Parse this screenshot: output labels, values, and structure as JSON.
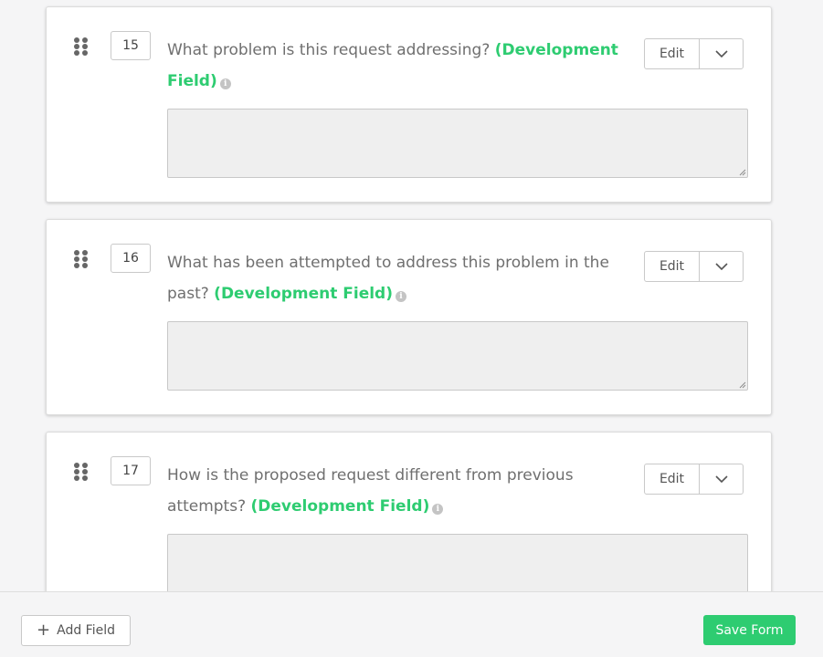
{
  "fields": [
    {
      "number": "15",
      "question": "What problem is this request addressing?",
      "tag": "(Development Field)",
      "info_icon": "info-icon",
      "edit_label": "Edit",
      "caret_icon": "chevron-down-icon"
    },
    {
      "number": "16",
      "question": "What has been attempted to address this problem in the past?",
      "tag": "(Development Field)",
      "info_icon": "info-icon",
      "edit_label": "Edit",
      "caret_icon": "chevron-down-icon"
    },
    {
      "number": "17",
      "question": "How is the proposed request different from previous attempts?",
      "tag": "(Development Field)",
      "info_icon": "info-icon",
      "edit_label": "Edit",
      "caret_icon": "chevron-down-icon"
    }
  ],
  "footer": {
    "add_field_label": "Add Field",
    "save_form_label": "Save Form"
  },
  "colors": {
    "accent_green": "#2ecc71",
    "text_gray": "#6f6f6f",
    "textarea_bg": "#efefef"
  }
}
